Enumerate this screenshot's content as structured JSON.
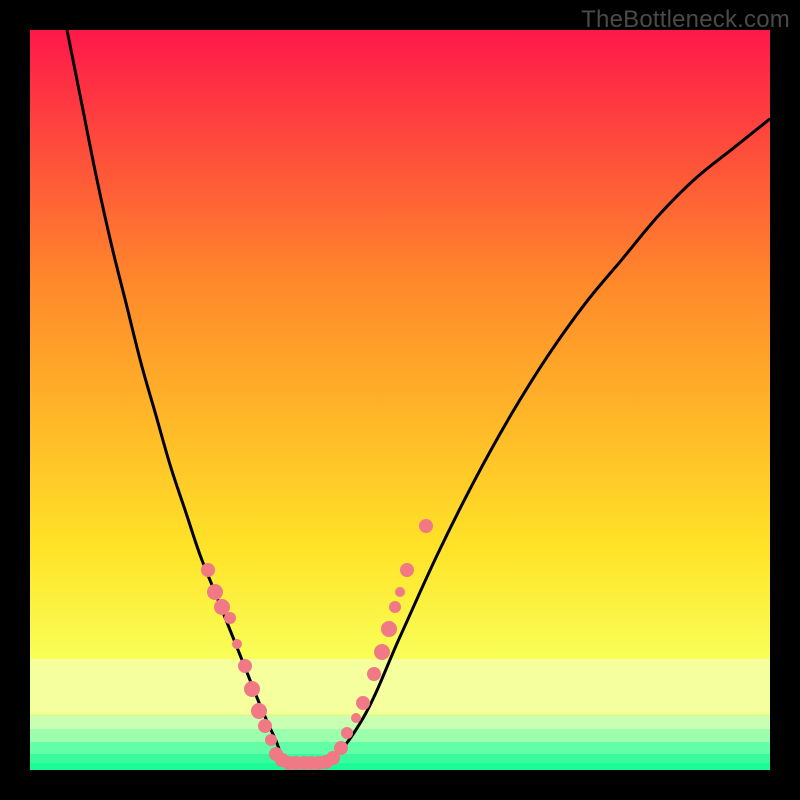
{
  "watermark": "TheBottleneck.com",
  "colors": {
    "black": "#000000",
    "gradient_top": "#fe184a",
    "gradient_mid1": "#ff8b2a",
    "gradient_mid2": "#ffe327",
    "gradient_band_pale": "#f6ff9d",
    "gradient_green1": "#b6ffa0",
    "gradient_green2": "#4fff9d",
    "gradient_green3": "#1dfa98",
    "curve": "#000000",
    "dot": "#f07985"
  },
  "chart_data": {
    "type": "line",
    "title": "",
    "xlabel": "",
    "ylabel": "",
    "xlim": [
      0,
      100
    ],
    "ylim": [
      0,
      100
    ],
    "series": [
      {
        "name": "bottleneck-curve",
        "x": [
          5,
          7,
          9,
          11,
          13,
          15,
          17,
          19,
          21,
          23,
          25,
          27,
          29,
          31,
          33,
          35,
          40,
          45,
          50,
          55,
          60,
          65,
          70,
          75,
          80,
          85,
          90,
          95,
          100
        ],
        "y": [
          100,
          90,
          80,
          71,
          63,
          55,
          48,
          41,
          35,
          29,
          24,
          19,
          14,
          9,
          4.5,
          1,
          1,
          7,
          18,
          29,
          39,
          48,
          56,
          63,
          69,
          75,
          80,
          84,
          88
        ]
      }
    ],
    "markers": [
      {
        "x": 24.0,
        "y": 27.0,
        "r": 7
      },
      {
        "x": 25.0,
        "y": 24.0,
        "r": 8
      },
      {
        "x": 26.0,
        "y": 22.0,
        "r": 8
      },
      {
        "x": 27.0,
        "y": 20.5,
        "r": 6
      },
      {
        "x": 28.0,
        "y": 17.0,
        "r": 5
      },
      {
        "x": 29.0,
        "y": 14.0,
        "r": 7
      },
      {
        "x": 30.0,
        "y": 11.0,
        "r": 8
      },
      {
        "x": 31.0,
        "y": 8.0,
        "r": 8
      },
      {
        "x": 31.8,
        "y": 6.0,
        "r": 7
      },
      {
        "x": 32.5,
        "y": 4.0,
        "r": 6
      },
      {
        "x": 33.3,
        "y": 2.2,
        "r": 7
      },
      {
        "x": 34.0,
        "y": 1.4,
        "r": 7
      },
      {
        "x": 35.0,
        "y": 1.0,
        "r": 7
      },
      {
        "x": 36.0,
        "y": 1.0,
        "r": 7
      },
      {
        "x": 37.0,
        "y": 1.0,
        "r": 7
      },
      {
        "x": 38.0,
        "y": 1.0,
        "r": 7
      },
      {
        "x": 39.0,
        "y": 1.0,
        "r": 7
      },
      {
        "x": 40.0,
        "y": 1.1,
        "r": 7
      },
      {
        "x": 41.0,
        "y": 1.6,
        "r": 7
      },
      {
        "x": 42.0,
        "y": 3.0,
        "r": 7
      },
      {
        "x": 42.8,
        "y": 5.0,
        "r": 6
      },
      {
        "x": 44.0,
        "y": 7.0,
        "r": 5
      },
      {
        "x": 45.0,
        "y": 9.0,
        "r": 7
      },
      {
        "x": 46.5,
        "y": 13.0,
        "r": 7
      },
      {
        "x": 47.5,
        "y": 16.0,
        "r": 8
      },
      {
        "x": 48.5,
        "y": 19.0,
        "r": 8
      },
      {
        "x": 49.3,
        "y": 22.0,
        "r": 6
      },
      {
        "x": 50.0,
        "y": 24.0,
        "r": 5
      },
      {
        "x": 51.0,
        "y": 27.0,
        "r": 7
      },
      {
        "x": 53.5,
        "y": 33.0,
        "r": 7
      }
    ],
    "gradient_stops": [
      {
        "pos": 0.0,
        "color": "#fe184a"
      },
      {
        "pos": 0.35,
        "color": "#ff8b2a"
      },
      {
        "pos": 0.7,
        "color": "#ffe327"
      },
      {
        "pos": 0.85,
        "color": "#f9ff59"
      }
    ],
    "bottom_bands": [
      {
        "from": 0.85,
        "to": 0.895,
        "color": "#f6ff9d"
      },
      {
        "from": 0.895,
        "to": 0.925,
        "color": "#f6ff9d"
      },
      {
        "from": 0.925,
        "to": 0.945,
        "color": "#c9ffb3"
      },
      {
        "from": 0.945,
        "to": 0.962,
        "color": "#9cffad"
      },
      {
        "from": 0.962,
        "to": 0.978,
        "color": "#63ffa6"
      },
      {
        "from": 0.978,
        "to": 0.99,
        "color": "#39fb9e"
      },
      {
        "from": 0.99,
        "to": 1.0,
        "color": "#1dfa98"
      }
    ]
  }
}
